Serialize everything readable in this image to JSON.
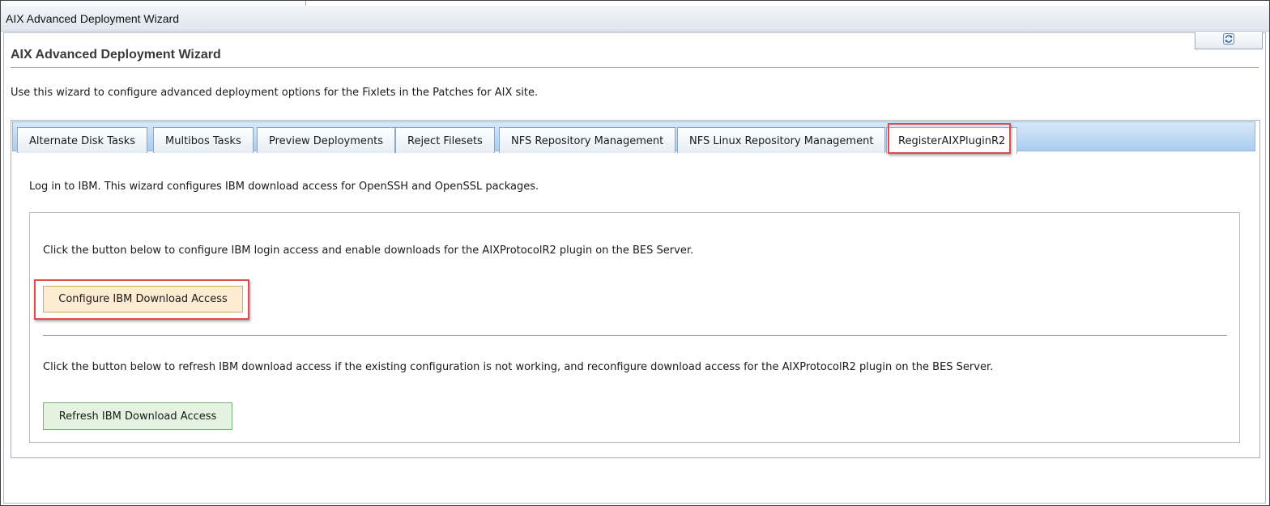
{
  "window": {
    "title": "AIX Advanced Deployment Wizard"
  },
  "header": {
    "refresh_icon": "refresh-icon"
  },
  "page": {
    "heading": "AIX Advanced Deployment Wizard",
    "intro": "Use this wizard to configure advanced deployment options for the Fixlets in the Patches for AIX site."
  },
  "tabs": [
    {
      "label": "Alternate Disk Tasks",
      "active": false
    },
    {
      "label": "Multibos Tasks",
      "active": false
    },
    {
      "label": "Preview Deployments",
      "active": false
    },
    {
      "label": "Reject Filesets",
      "active": false
    },
    {
      "label": "NFS Repository Management",
      "active": false
    },
    {
      "label": "NFS Linux Repository Management",
      "active": false
    },
    {
      "label": "RegisterAIXPluginR2",
      "active": true
    }
  ],
  "register_tab": {
    "description": "Log in to IBM. This wizard configures IBM download access for OpenSSH and OpenSSL packages.",
    "configure_instruction": "Click the button below to configure IBM login access and enable downloads for the AIXProtocolR2 plugin on the BES Server.",
    "configure_button": "Configure IBM Download Access",
    "refresh_instruction": "Click the button below to refresh IBM download access if the existing configuration is not working, and reconfigure download access for the AIXProtocolR2 plugin on the BES Server.",
    "refresh_button": "Refresh IBM Download Access"
  },
  "colors": {
    "highlight": "#e24b4b",
    "configure_button_bg": "#fdebd2",
    "refresh_button_bg": "#e4f2e0",
    "heading_rule": "#9db53c"
  }
}
